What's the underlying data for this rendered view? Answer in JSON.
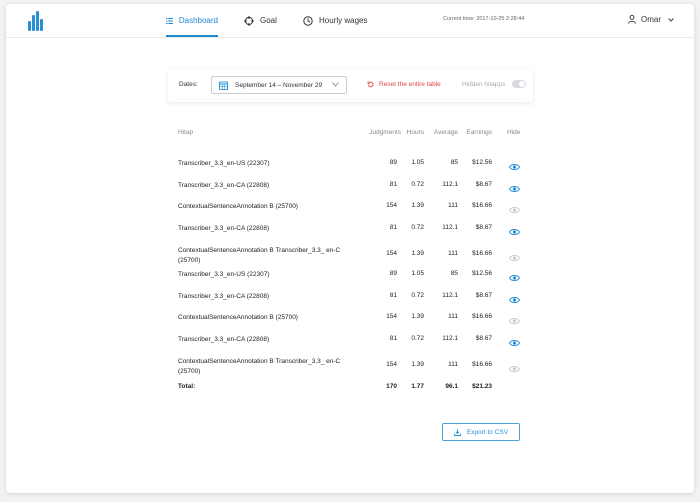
{
  "nav": {
    "items": [
      {
        "label": "Dashboard",
        "icon": "list-icon"
      },
      {
        "label": "Goal",
        "icon": "target-icon"
      },
      {
        "label": "Hourly wages",
        "icon": "clock-icon"
      }
    ],
    "active_index": 0,
    "current_time": "Current time: 2017-10-25 2:28:44",
    "user_name": "Omar"
  },
  "filters": {
    "dates_label": "Dates:",
    "date_range": "September 14 – November  29",
    "reset_label": "Reset the entire table",
    "hidden_label": "Hidden hitapps",
    "hidden_toggle_on": false
  },
  "table": {
    "headers": {
      "hitap": "Hitap",
      "judgments": "Judgments",
      "hours": "Hours",
      "average": "Average",
      "earnings": "Earnings",
      "hide": "Hide"
    },
    "rows": [
      {
        "hitap": "Transcriber_3.3_en-US (22307)",
        "judgments": "89",
        "hours": "1.05",
        "average": "85",
        "earnings": "$12.56",
        "visible": true
      },
      {
        "hitap": "Transcriber_3.3_en-CA (22808)",
        "judgments": "81",
        "hours": "0.72",
        "average": "112.1",
        "earnings": "$8.67",
        "visible": true
      },
      {
        "hitap": "ContextualSentenceAnnotation B (25700)",
        "judgments": "154",
        "hours": "1.39",
        "average": "111",
        "earnings": "$16.66",
        "visible": false
      },
      {
        "hitap": "Transcriber_3.3_en-CA (22808)",
        "judgments": "81",
        "hours": "0.72",
        "average": "112.1",
        "earnings": "$8.67",
        "visible": true
      },
      {
        "hitap": "ContextualSentenceAnnotation B Transcriber_3.3_ en-C (25700)",
        "judgments": "154",
        "hours": "1.39",
        "average": "111",
        "earnings": "$16.66",
        "visible": false
      },
      {
        "hitap": "Transcriber_3.3_en-US (22307)",
        "judgments": "89",
        "hours": "1.05",
        "average": "85",
        "earnings": "$12.56",
        "visible": true
      },
      {
        "hitap": "Transcriber_3.3_en-CA (22808)",
        "judgments": "81",
        "hours": "0.72",
        "average": "112.1",
        "earnings": "$8.67",
        "visible": true
      },
      {
        "hitap": "ContextualSentenceAnnotation B (25700)",
        "judgments": "154",
        "hours": "1.39",
        "average": "111",
        "earnings": "$16.66",
        "visible": false
      },
      {
        "hitap": "Transcriber_3.3_en-CA (22808)",
        "judgments": "81",
        "hours": "0.72",
        "average": "112.1",
        "earnings": "$8.67",
        "visible": true
      },
      {
        "hitap": "ContextualSentenceAnnotation B Transcriber_3.3_ en-C (25700)",
        "judgments": "154",
        "hours": "1.39",
        "average": "111",
        "earnings": "$16.66",
        "visible": false
      }
    ],
    "total": {
      "label": "Total:",
      "judgments": "170",
      "hours": "1.77",
      "average": "96.1",
      "earnings": "$21.23"
    }
  },
  "export_label": "Export to CSV",
  "colors": {
    "accent": "#1e88d0",
    "danger": "#e0474c",
    "eye_active": "#2b8fd6",
    "eye_hidden": "#c8ccd1"
  }
}
